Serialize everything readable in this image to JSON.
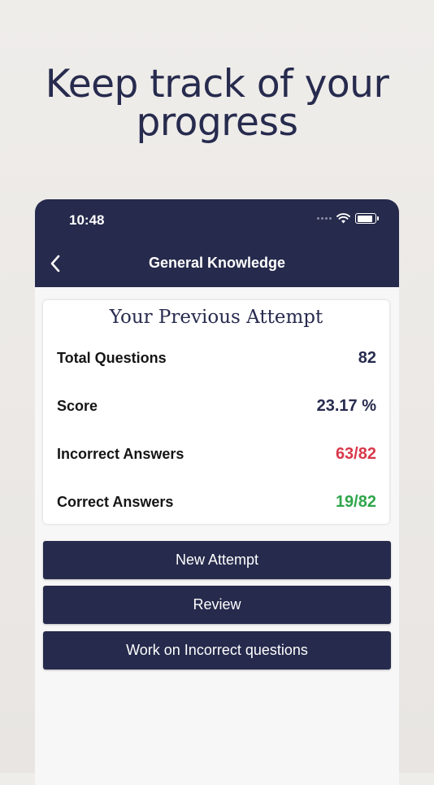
{
  "headline": {
    "line1": "Keep track of your",
    "line2": "progress"
  },
  "status_bar": {
    "time": "10:48",
    "icons": [
      "signal-dots-icon",
      "wifi-icon",
      "battery-icon"
    ]
  },
  "nav": {
    "title": "General Knowledge",
    "back_icon": "chevron-left-icon"
  },
  "card": {
    "title": "Your Previous Attempt",
    "rows": [
      {
        "label": "Total Questions",
        "value": "82"
      },
      {
        "label": "Score",
        "value": "23.17 %"
      },
      {
        "label": "Incorrect Answers",
        "value": "63/82"
      },
      {
        "label": "Correct Answers",
        "value": "19/82"
      }
    ]
  },
  "buttons": {
    "new_attempt": "New Attempt",
    "review": "Review",
    "work_incorrect": "Work on Incorrect questions"
  },
  "colors": {
    "navy": "#262a4c",
    "incorrect": "#d8384b",
    "correct": "#2fa64c"
  }
}
